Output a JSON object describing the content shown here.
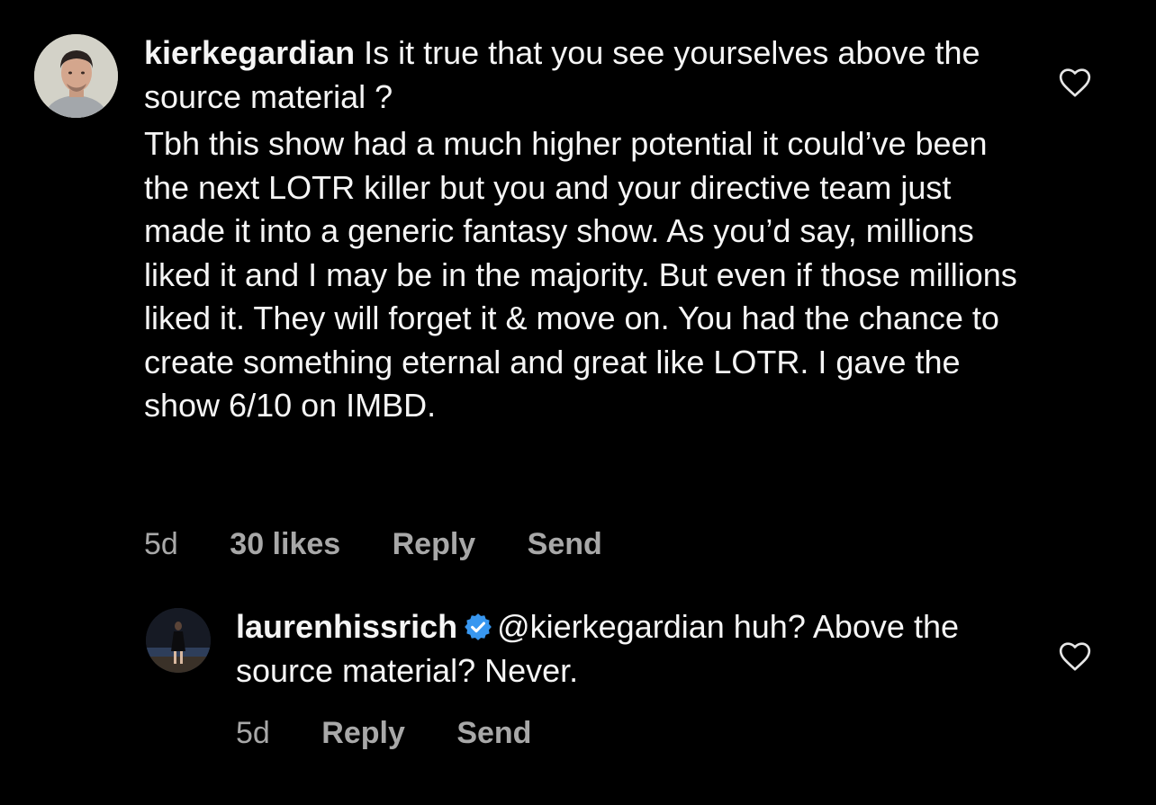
{
  "comments": [
    {
      "username": "kierkegardian",
      "text_line1": "Is it true that you see yourselves above the source material ?",
      "paragraph": "Tbh this show had a much higher potential it could’ve been the next LOTR killer but you and your directive team just made it into a generic fantasy show. As you’d say, millions liked it and I may be in the majority. But even if those millions liked it. They will forget it & move on. You had the chance to create something eternal and great like LOTR. I gave the show 6/10 on IMBD.",
      "age": "5d",
      "likes": "30 likes",
      "reply_label": "Reply",
      "send_label": "Send",
      "like_icon": "heart-outline-icon"
    },
    {
      "username": "laurenhissrich",
      "verified_icon": "verified-badge-icon",
      "verified_color": "#3897f0",
      "text": "@kierkegardian huh? Above the source material? Never.",
      "age": "5d",
      "reply_label": "Reply",
      "send_label": "Send",
      "like_icon": "heart-outline-icon"
    }
  ],
  "colors": {
    "background": "#000000",
    "primary_text": "#f5f5f5",
    "secondary_text": "#a8a8a8"
  }
}
